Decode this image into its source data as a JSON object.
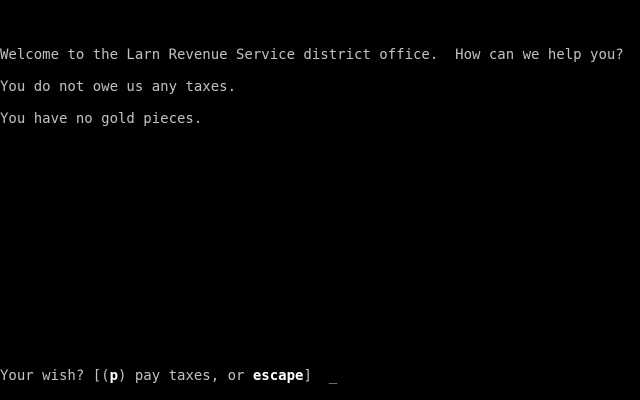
{
  "messages": [
    "Welcome to the Larn Revenue Service district office.  How can we help you?",
    "You do not owe us any taxes.",
    "You have no gold pieces."
  ],
  "prompt": {
    "prefix": "Your wish? [(",
    "key_pay": "p",
    "pay_text": ") pay taxes, or ",
    "key_escape": "escape",
    "suffix": "]  ",
    "cursor": "_"
  },
  "colors": {
    "background": "#000000",
    "text": "#c0c0c0",
    "highlight": "#ffffff"
  }
}
